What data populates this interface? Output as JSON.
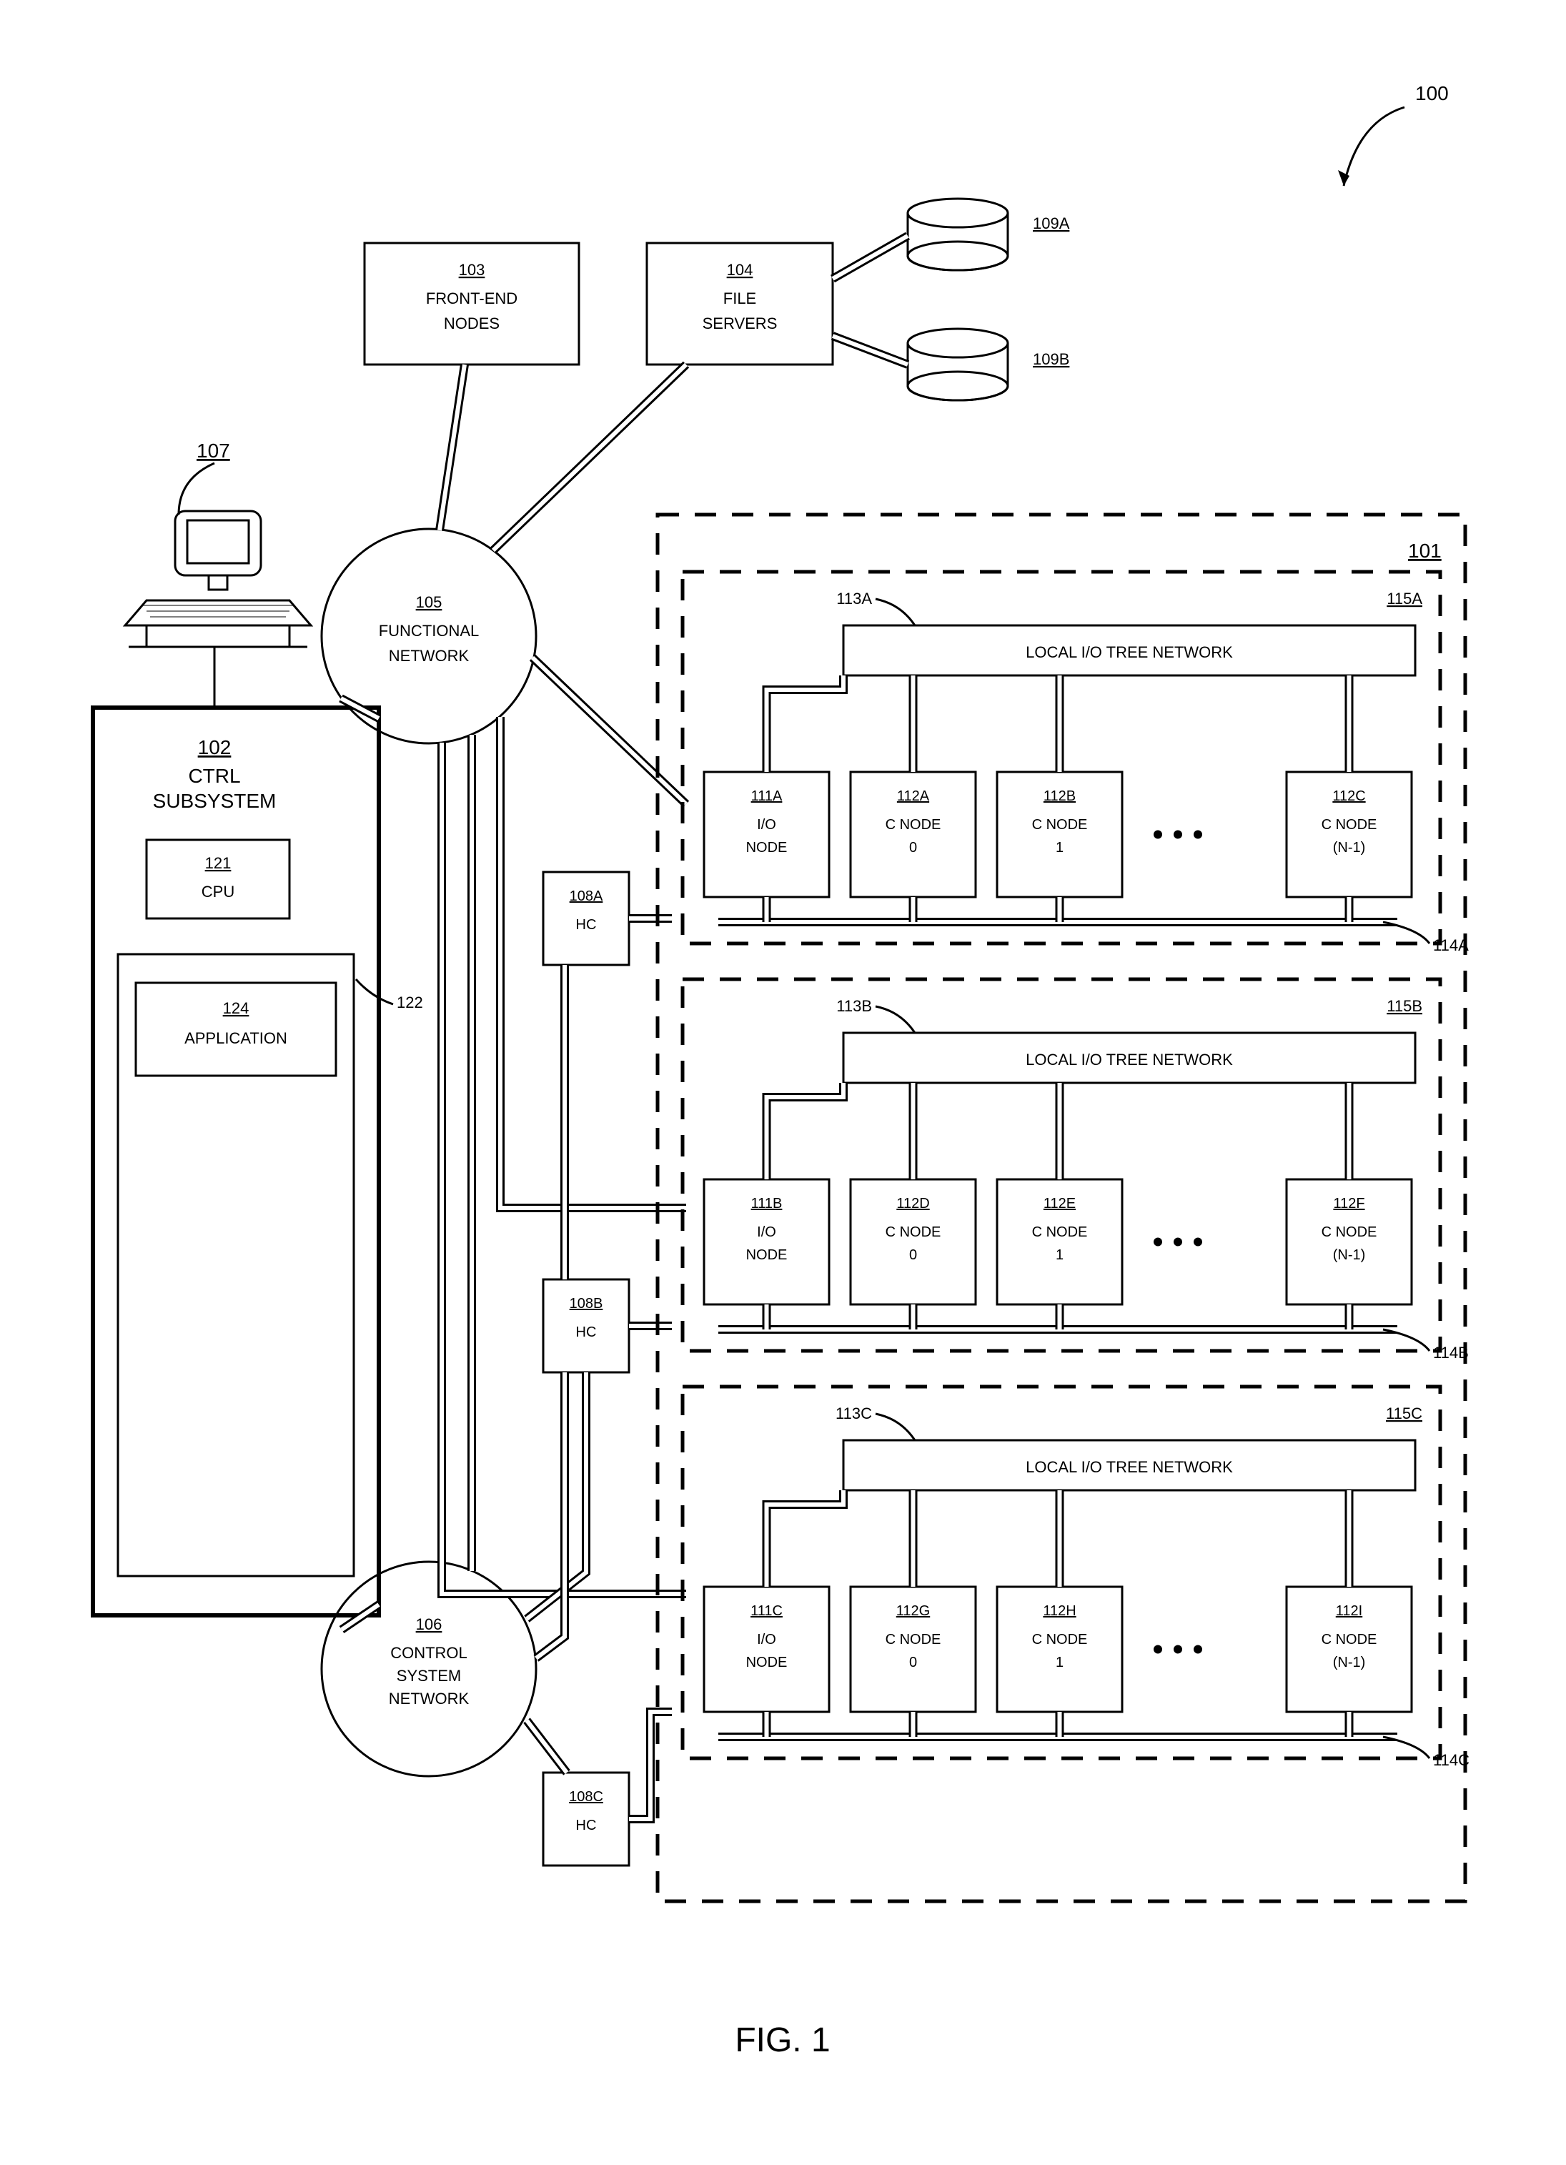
{
  "figure_label": "FIG. 1",
  "overall_ref": "100",
  "terminal_ref": "107",
  "ctrl_subsystem": {
    "ref": "102",
    "title": "CTRL\nSUBSYSTEM",
    "cpu": {
      "ref": "121",
      "label": "CPU"
    },
    "app": {
      "ref": "124",
      "label": "APPLICATION"
    },
    "mem_ref": "122"
  },
  "front_end": {
    "ref": "103",
    "label": "FRONT-END\nNODES"
  },
  "file_servers": {
    "ref": "104",
    "label": "FILE\nSERVERS"
  },
  "db_a": "109A",
  "db_b": "109B",
  "functional_net": {
    "ref": "105",
    "label": "FUNCTIONAL\nNETWORK"
  },
  "control_net": {
    "ref": "106",
    "label": "CONTROL\nSYSTEM\nNETWORK"
  },
  "hc": [
    {
      "ref": "108A",
      "label": "HC"
    },
    {
      "ref": "108B",
      "label": "HC"
    },
    {
      "ref": "108C",
      "label": "HC"
    }
  ],
  "compute_lattice_ref": "101",
  "psets": [
    {
      "pset_ref": "115A",
      "tree_ref": "113A",
      "bus_ref": "114A",
      "tree_label": "LOCAL I/O TREE NETWORK",
      "io": {
        "ref": "111A",
        "label": "I/O\nNODE"
      },
      "nodes": [
        {
          "ref": "112A",
          "label": "C NODE\n0"
        },
        {
          "ref": "112B",
          "label": "C NODE\n1"
        },
        {
          "ref": "112C",
          "label": "C NODE\n(N-1)"
        }
      ]
    },
    {
      "pset_ref": "115B",
      "tree_ref": "113B",
      "bus_ref": "114B",
      "tree_label": "LOCAL I/O TREE NETWORK",
      "io": {
        "ref": "111B",
        "label": "I/O\nNODE"
      },
      "nodes": [
        {
          "ref": "112D",
          "label": "C NODE\n0"
        },
        {
          "ref": "112E",
          "label": "C NODE\n1"
        },
        {
          "ref": "112F",
          "label": "C NODE\n(N-1)"
        }
      ]
    },
    {
      "pset_ref": "115C",
      "tree_ref": "113C",
      "bus_ref": "114C",
      "tree_label": "LOCAL I/O TREE NETWORK",
      "io": {
        "ref": "111C",
        "label": "I/O\nNODE"
      },
      "nodes": [
        {
          "ref": "112G",
          "label": "C NODE\n0"
        },
        {
          "ref": "112H",
          "label": "C NODE\n1"
        },
        {
          "ref": "112I",
          "label": "C NODE\n(N-1)"
        }
      ]
    }
  ]
}
